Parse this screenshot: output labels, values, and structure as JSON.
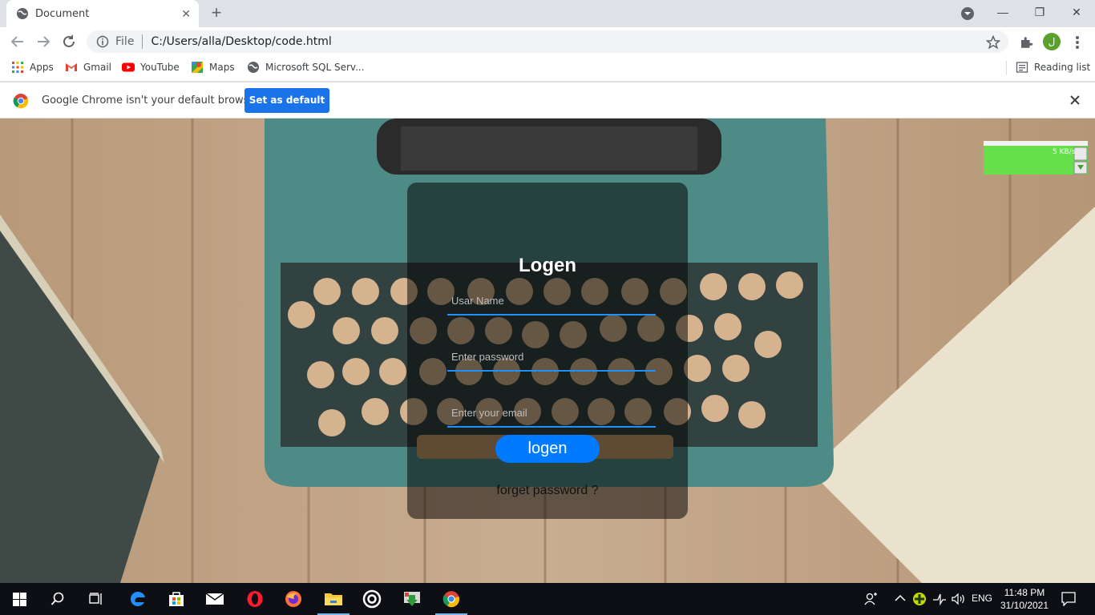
{
  "browser": {
    "tab": {
      "title": "Document",
      "close": "✕"
    },
    "new_tab": "+",
    "window_controls": {
      "minimize": "—",
      "restore": "❐",
      "close": "✕"
    },
    "omnibox": {
      "scheme": "File",
      "url": "C:/Users/alla/Desktop/code.html"
    },
    "profile_initial": "ل",
    "bookmarks": [
      {
        "label": "Apps",
        "icon": "apps-grid-icon"
      },
      {
        "label": "Gmail",
        "icon": "gmail-icon"
      },
      {
        "label": "YouTube",
        "icon": "youtube-icon"
      },
      {
        "label": "Maps",
        "icon": "maps-icon"
      },
      {
        "label": "Microsoft SQL Serv...",
        "icon": "globe-icon"
      }
    ],
    "reading_list": "Reading list"
  },
  "infobar": {
    "message": "Google Chrome isn't your default browser",
    "button": "Set as default",
    "close": "✕"
  },
  "login": {
    "title": "Logen",
    "username_placeholder": "Usar Name",
    "password_placeholder": "Enter password",
    "email_placeholder": "Enter your email",
    "button": "logen",
    "forget": "forget password ?"
  },
  "net_meter": {
    "rate": "5 KB/s"
  },
  "taskbar": {
    "language": "ENG",
    "time": "11:48 PM",
    "date": "31/10/2021"
  },
  "colors": {
    "accent": "#1a73e8",
    "login_button": "#007bff",
    "field_line": "#1e90ff",
    "taskbar": "#0d0f14"
  }
}
